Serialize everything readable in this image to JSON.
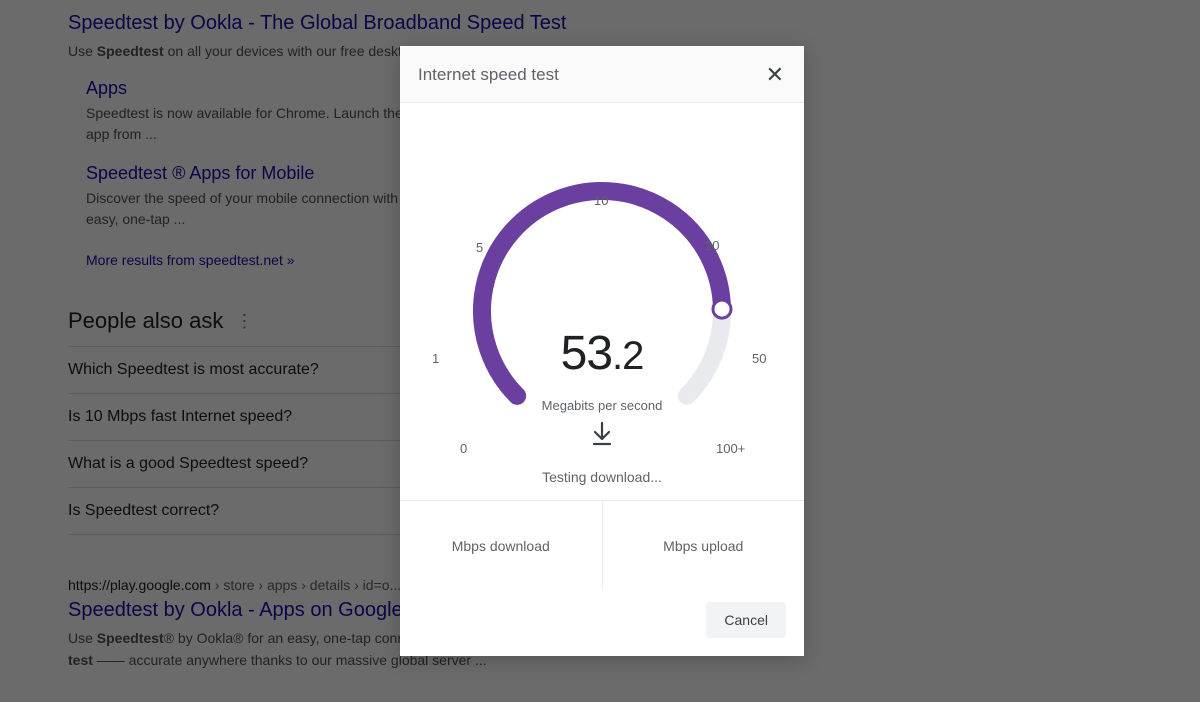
{
  "search": {
    "results": [
      {
        "title": "Speedtest by Ookla - The Global Broadband Speed Test",
        "snippet_pre": "Use ",
        "snippet_bold": "Speedtest",
        "snippet_post": " on all your devices with our free desktop and mobile apps.",
        "sitelinks": [
          {
            "title": "Apps",
            "desc": "Speedtest is now available for Chrome. Launch the app from ..."
          },
          {
            "title": "Speedtest ® Apps for Mobile",
            "desc": "Discover the speed of your mobile connection with easy, one-tap ..."
          }
        ],
        "more": "More results from speedtest.net »"
      }
    ],
    "paa": {
      "heading": "People also ask",
      "items": [
        "Which Speedtest is most accurate?",
        "Is 10 Mbps fast Internet speed?",
        "What is a good Speedtest speed?",
        "Is Speedtest correct?"
      ]
    },
    "result2": {
      "breadcrumb_host": "https://play.google.com",
      "breadcrumb_path": " › store › apps › details › id=o...",
      "title": "Speedtest by Ookla - Apps on Google",
      "snippet_pre": "Use ",
      "snippet_b1": "Speedtest",
      "snippet_mid": "® by Ookla® for an easy, one-tap connection internet performance and ",
      "snippet_b2": "speed test",
      "snippet_post": " —— accurate anywhere thanks to our massive global server ..."
    }
  },
  "modal": {
    "title": "Internet speed test",
    "speed_int": "53",
    "speed_frac": ".2",
    "unit": "Megabits per second",
    "status": "Testing download...",
    "download_label": "Mbps download",
    "upload_label": "Mbps upload",
    "cancel": "Cancel",
    "ticks": {
      "t0": "0",
      "t1": "1",
      "t5": "5",
      "t10": "10",
      "t20": "20",
      "t50": "50",
      "t100": "100+"
    },
    "gauge": {
      "max_label": "100+",
      "fill_fraction": 0.83,
      "colors": {
        "track": "#e8eaed",
        "fill": "#6b3fa0",
        "knob_border": "#6b3fa0"
      }
    }
  },
  "chart_data": {
    "type": "gauge",
    "title": "Internet speed test",
    "value": 53.2,
    "unit": "Megabits per second",
    "ticks": [
      0,
      1,
      5,
      10,
      20,
      50,
      100
    ],
    "tick_labels": [
      "0",
      "1",
      "5",
      "10",
      "20",
      "50",
      "100+"
    ],
    "arc_start_deg": 225,
    "arc_end_deg": -45,
    "fill_fraction": 0.83,
    "status": "Testing download..."
  }
}
